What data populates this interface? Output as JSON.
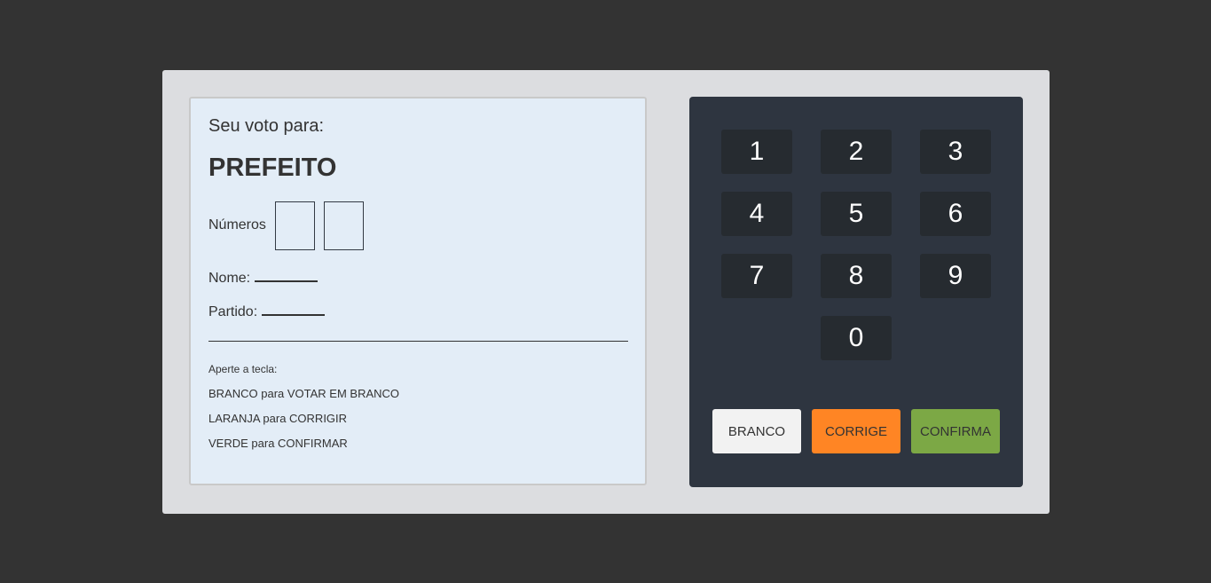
{
  "screen": {
    "vote_for": "Seu voto para:",
    "office": "PREFEITO",
    "numbers_label": "Números",
    "name_label": "Nome:",
    "party_label": "Partido:",
    "instructions": {
      "title": "Aperte a tecla:",
      "line1": "BRANCO para VOTAR EM BRANCO",
      "line2": "LARANJA para CORRIGIR",
      "line3": "VERDE para CONFIRMAR"
    }
  },
  "keypad": {
    "keys": [
      "1",
      "2",
      "3",
      "4",
      "5",
      "6",
      "7",
      "8",
      "9",
      "0"
    ]
  },
  "actions": {
    "branco": "BRANCO",
    "corrige": "CORRIGE",
    "confirma": "CONFIRMA"
  },
  "colors": {
    "background": "#333333",
    "panel": "#dcdde0",
    "screen": "#e3edf7",
    "keypad": "#2e3540",
    "key": "#262b30",
    "branco": "#f2f2f2",
    "corrige": "#ff8524",
    "confirma": "#7ca845"
  }
}
